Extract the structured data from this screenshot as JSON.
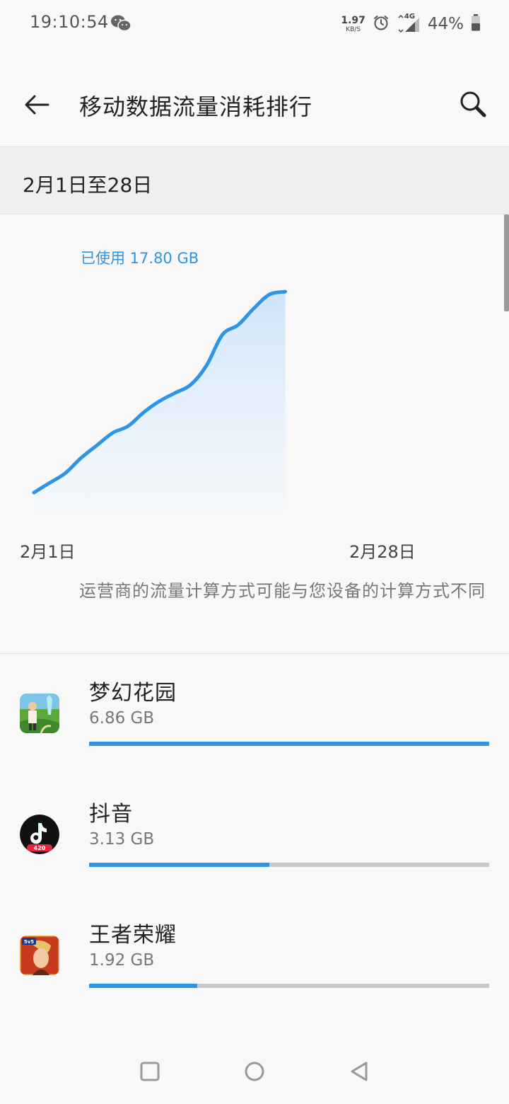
{
  "status_bar": {
    "time": "19:10:54",
    "net_speed_value": "1.97",
    "net_speed_unit": "KB/S",
    "network_type": "4G",
    "battery": "44%"
  },
  "toolbar": {
    "title": "移动数据流量消耗排行"
  },
  "date_range": {
    "label": "2月1日至28日"
  },
  "chart": {
    "usage_label": "已使用 17.80 GB",
    "x_start_label": "2月1日",
    "x_end_label": "2月28日"
  },
  "chart_data": {
    "type": "area",
    "title": "已使用 17.80 GB",
    "x": [
      "2月1日",
      "2月28日"
    ],
    "series": [
      {
        "values": [
          {
            "day": 1,
            "gb": 0.0
          },
          {
            "day": 2,
            "gb": 0.7
          },
          {
            "day": 3,
            "gb": 1.4
          },
          {
            "day": 4,
            "gb": 2.5
          },
          {
            "day": 5,
            "gb": 3.4
          },
          {
            "day": 6,
            "gb": 4.3
          },
          {
            "day": 7,
            "gb": 4.8
          },
          {
            "day": 8,
            "gb": 5.8
          },
          {
            "day": 9,
            "gb": 6.6
          },
          {
            "day": 10,
            "gb": 7.2
          },
          {
            "day": 11,
            "gb": 7.8
          },
          {
            "day": 12,
            "gb": 9.2
          },
          {
            "day": 13,
            "gb": 11.4
          },
          {
            "day": 14,
            "gb": 12.1
          },
          {
            "day": 15,
            "gb": 13.3
          },
          {
            "day": 16,
            "gb": 14.3
          },
          {
            "day": 17,
            "gb": 14.5
          }
        ]
      }
    ],
    "total_gb": 17.8,
    "month_days": 28,
    "line_color": "#2e94e6",
    "fill_color": "#d6e8fa"
  },
  "carrier_note": "运营商的流量计算方式可能与您设备的计算方式不同",
  "apps": [
    {
      "name": "梦幻花园",
      "usage": "6.86 GB",
      "fraction": 1.0,
      "icon": "gardenscapes-icon"
    },
    {
      "name": "抖音",
      "usage": "3.13 GB",
      "fraction": 0.45,
      "icon": "douyin-icon"
    },
    {
      "name": "王者荣耀",
      "usage": "1.92 GB",
      "fraction": 0.27,
      "icon": "honor-of-kings-icon"
    }
  ],
  "colors": {
    "accent": "#2e94e6",
    "track": "#c8c8c8"
  }
}
